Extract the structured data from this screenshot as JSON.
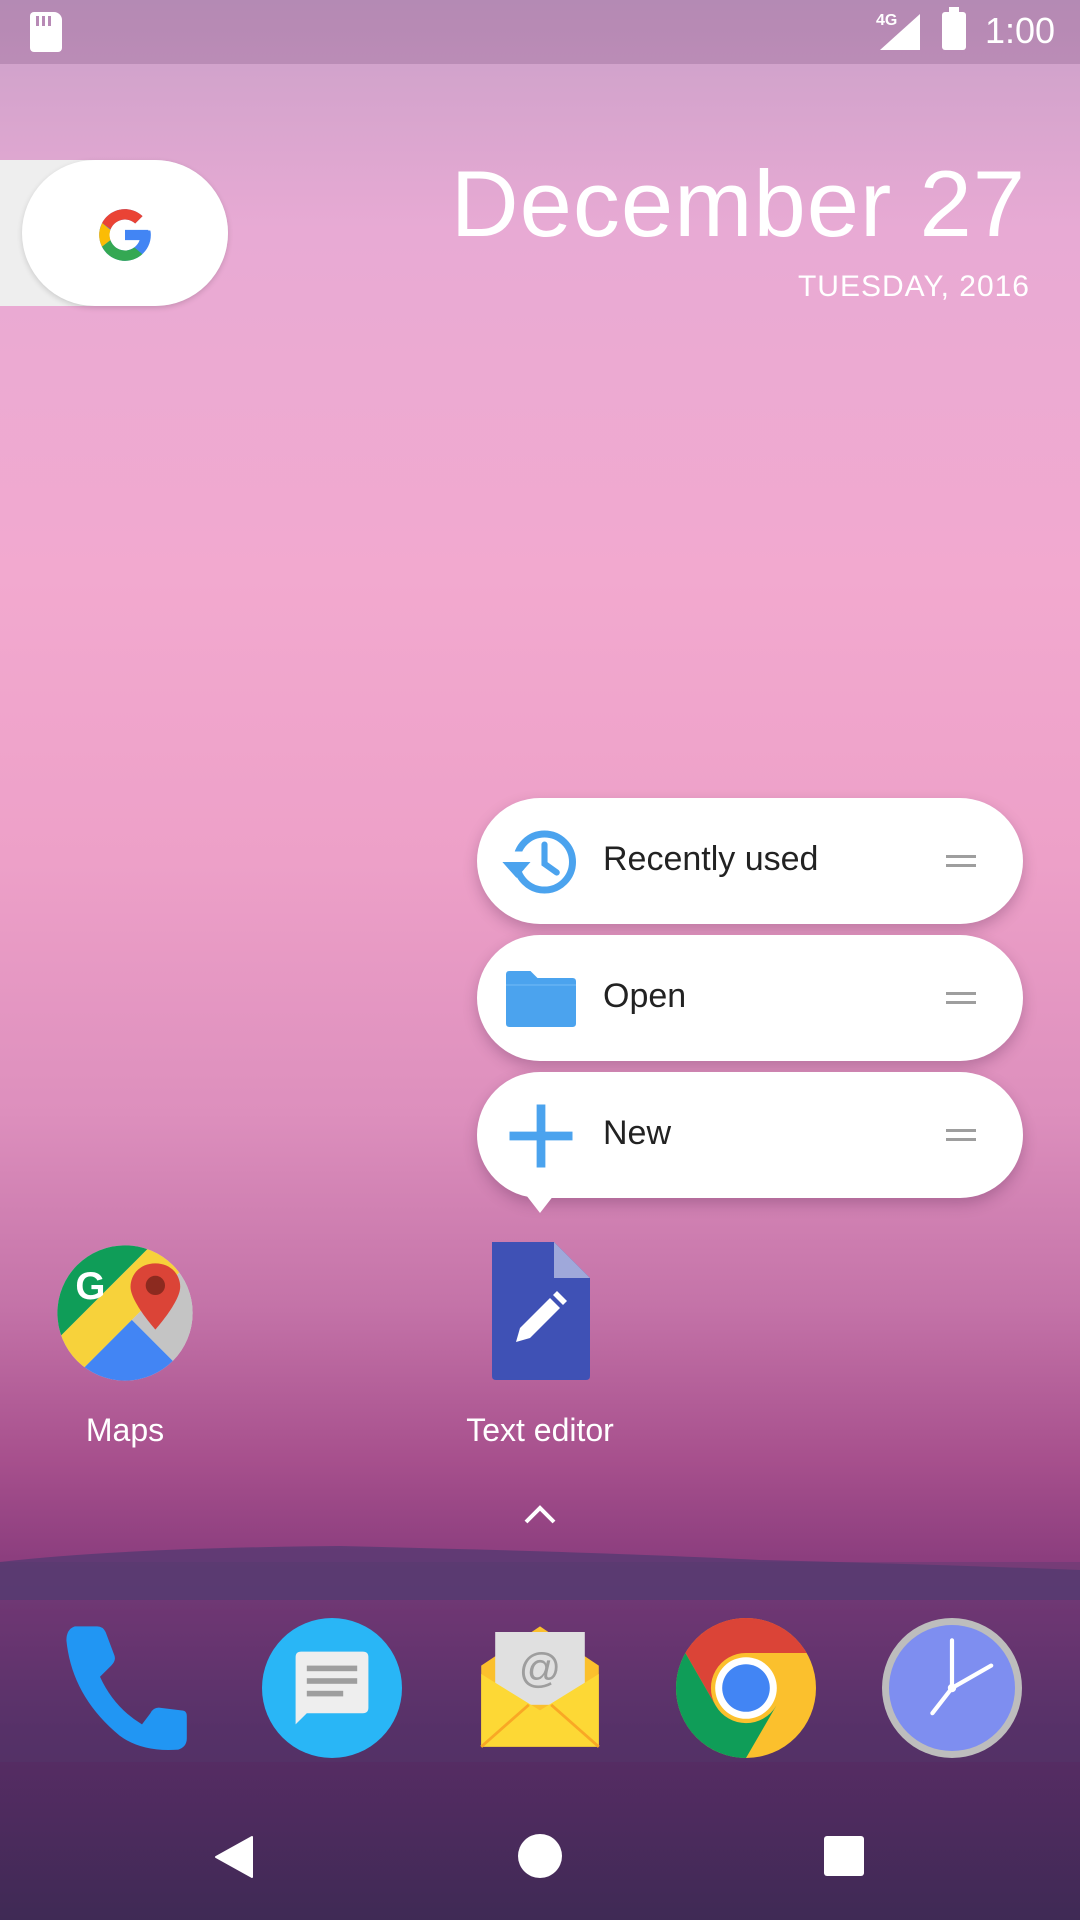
{
  "status_bar": {
    "network": "4G",
    "time": "1:00"
  },
  "widget": {
    "date": "December 27",
    "weekday_year": "TUESDAY, 2016"
  },
  "shortcut_menu": {
    "items": [
      {
        "label": "Recently used",
        "icon": "history-icon"
      },
      {
        "label": "Open",
        "icon": "folder-icon"
      },
      {
        "label": "New",
        "icon": "plus-icon"
      }
    ]
  },
  "apps": [
    {
      "label": "Maps",
      "icon": "maps-icon"
    },
    {
      "label": "Text editor",
      "icon": "text-editor-icon"
    }
  ],
  "dock": [
    "phone-icon",
    "messages-icon",
    "email-icon",
    "chrome-icon",
    "clock-icon"
  ],
  "colors": {
    "accent_blue": "#4ba3ee",
    "text_editor_indigo": "#3f51b5"
  }
}
